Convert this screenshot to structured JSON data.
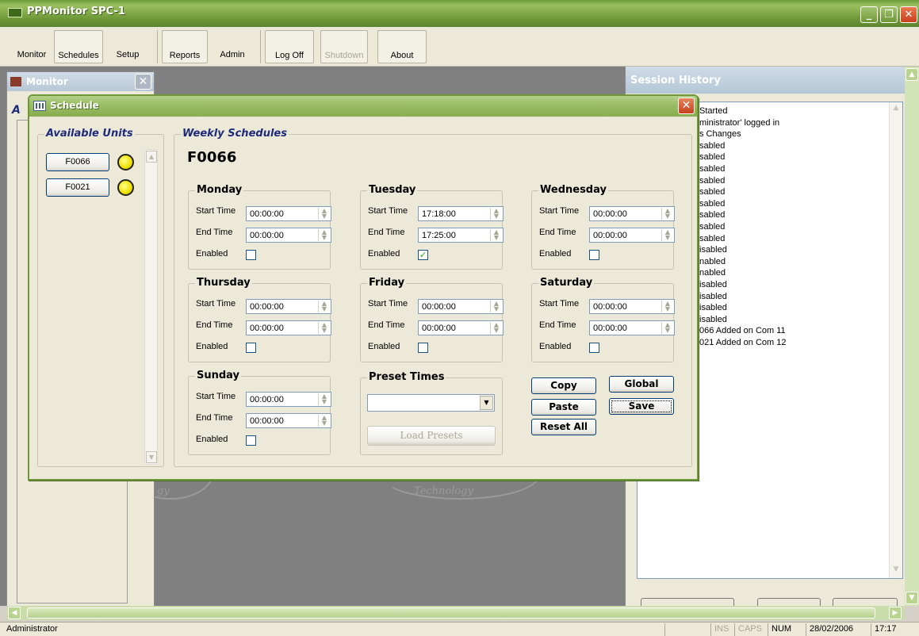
{
  "window": {
    "title": "PPMonitor SPC-1",
    "min": "_",
    "max": "❐",
    "close": "✕"
  },
  "toolbar": {
    "monitor": "Monitor",
    "schedules": "Schedules",
    "setup": "Setup",
    "reports": "Reports",
    "admin": "Admin",
    "logoff": "Log Off",
    "shutdown": "Shutdown",
    "about": "About"
  },
  "monitor_window": {
    "title": "Monitor",
    "heading": "A",
    "close": "✕"
  },
  "background": {
    "logo_left": "gy",
    "logo_right": "Technology"
  },
  "session_history": {
    "title": "Session History",
    "lines": [
      "Started",
      "ministrator' logged in",
      "s Changes",
      "sabled",
      "sabled",
      "sabled",
      "sabled",
      "sabled",
      "sabled",
      "sabled",
      "sabled",
      "sabled",
      "isabled",
      "nabled",
      "nabled",
      "isabled",
      "isabled",
      "isabled",
      "isabled",
      "066 Added on Com 11",
      "021 Added on Com 12"
    ]
  },
  "schedule": {
    "title": "Schedule",
    "close": "✕",
    "available_units_label": "Available Units",
    "weekly_label": "Weekly Schedules",
    "selected_unit": "F0066",
    "units": [
      {
        "name": "F0066",
        "status_color": "#f0e000"
      },
      {
        "name": "F0021",
        "status_color": "#f0e000"
      }
    ],
    "labels": {
      "start": "Start Time",
      "end": "End Time",
      "enabled": "Enabled"
    },
    "days": [
      {
        "name": "Monday",
        "start": "00:00:00",
        "end": "00:00:00",
        "enabled": false
      },
      {
        "name": "Tuesday",
        "start": "17:18:00",
        "end": "17:25:00",
        "enabled": true
      },
      {
        "name": "Wednesday",
        "start": "00:00:00",
        "end": "00:00:00",
        "enabled": false
      },
      {
        "name": "Thursday",
        "start": "00:00:00",
        "end": "00:00:00",
        "enabled": false
      },
      {
        "name": "Friday",
        "start": "00:00:00",
        "end": "00:00:00",
        "enabled": false
      },
      {
        "name": "Saturday",
        "start": "00:00:00",
        "end": "00:00:00",
        "enabled": false
      },
      {
        "name": "Sunday",
        "start": "00:00:00",
        "end": "00:00:00",
        "enabled": false
      }
    ],
    "preset": {
      "label": "Preset Times",
      "value": "",
      "load_button": "Load Presets"
    },
    "buttons": {
      "copy": "Copy",
      "global": "Global",
      "paste": "Paste",
      "save": "Save",
      "reset": "Reset All"
    }
  },
  "statusbar": {
    "user": "Administrator",
    "ins": "INS",
    "caps": "CAPS",
    "num": "NUM",
    "date": "28/02/2006",
    "time": "17:17"
  }
}
